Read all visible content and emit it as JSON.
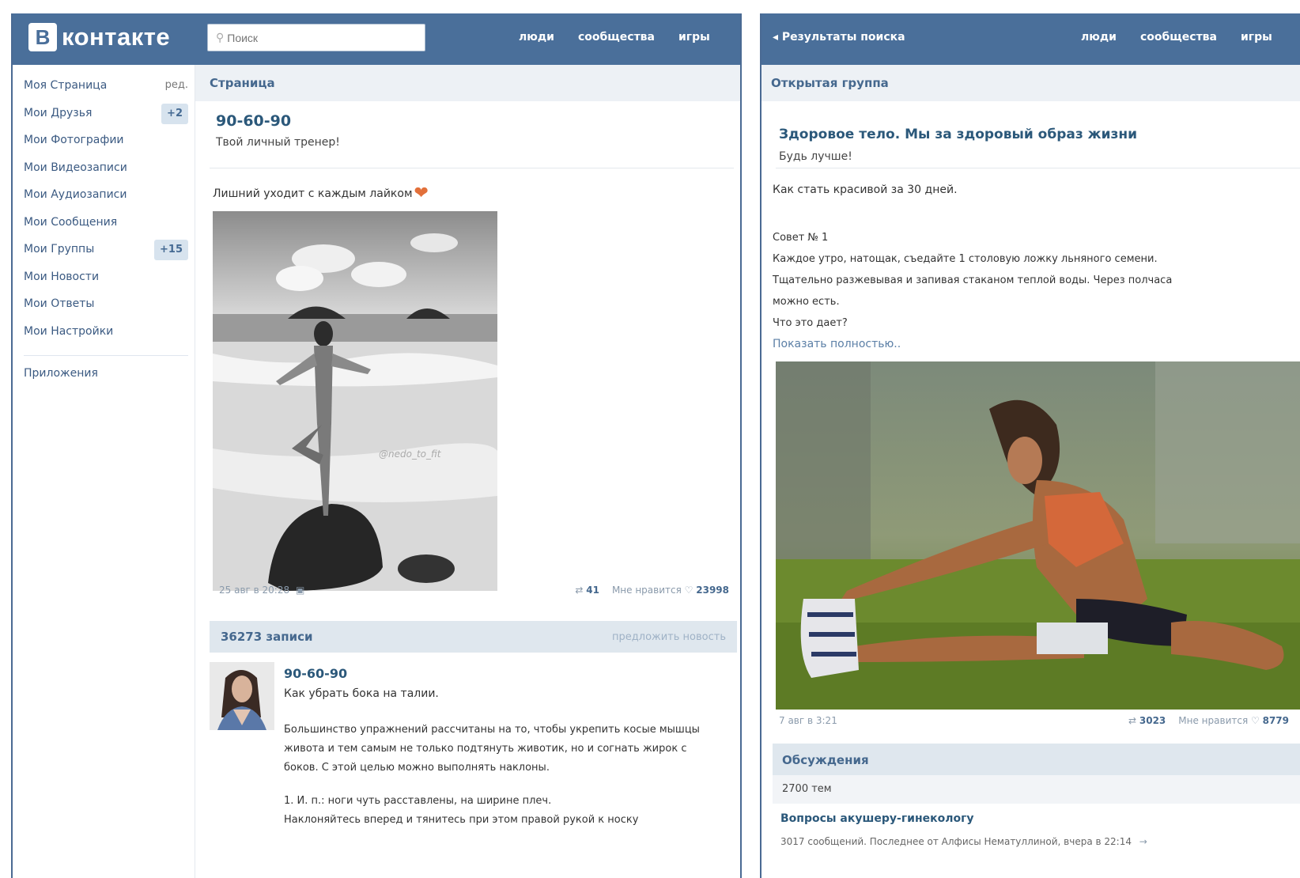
{
  "left": {
    "logo": {
      "letter": "В",
      "text": "контакте"
    },
    "search_placeholder": "Поиск",
    "nav": [
      "люди",
      "сообщества",
      "игры"
    ],
    "sidebar": {
      "items": [
        {
          "label": "Моя Страница",
          "extra": "ред."
        },
        {
          "label": "Мои Друзья",
          "badge": "+2"
        },
        {
          "label": "Мои Фотографии"
        },
        {
          "label": "Мои Видеозаписи"
        },
        {
          "label": "Мои Аудиозаписи"
        },
        {
          "label": "Мои Сообщения"
        },
        {
          "label": "Мои Группы",
          "badge": "+15"
        },
        {
          "label": "Мои Новости"
        },
        {
          "label": "Мои Ответы"
        },
        {
          "label": "Мои Настройки"
        }
      ],
      "apps": "Приложения"
    },
    "section_title": "Страница",
    "page": {
      "title": "90-60-90",
      "subtitle": "Твой личный тренер!"
    },
    "post": {
      "text": "Лишний уходит с каждым лайком",
      "heart": "❤",
      "watermark": "@nedo_to_fit",
      "date": "25 авг в 20:28",
      "reposts": "41",
      "likes_label": "Мне нравится",
      "likes": "23998"
    },
    "wall": {
      "count": "36273 записи",
      "link": "предложить новость"
    },
    "post2": {
      "author": "90-60-90",
      "title": "Как убрать бока на талии.",
      "p1": "Большинство упражнений рассчитаны на то, чтобы укрепить косые мышцы живота и тем самым не только подтянуть животик, но и согнать жирок с боков. С этой целью можно выполнять наклоны.",
      "p2": "1. И. п.: ноги чуть расставлены, на ширине плеч.",
      "p3": "Наклоняйтесь вперед и тянитесь при этом правой рукой к носку"
    }
  },
  "right": {
    "back": "Результаты поиска",
    "nav": [
      "люди",
      "сообщества",
      "игры"
    ],
    "section_title": "Открытая группа",
    "group": {
      "title": "Здоровое тело. Мы за здоровый образ жизни",
      "subtitle": "Будь лучше!"
    },
    "post": {
      "intro": "Как стать красивой за 30 дней.",
      "tip_title": "Совет № 1",
      "tip_l1": "Каждое утро, натощак, съедайте 1 столовую ложку льняного семени.",
      "tip_l2": "Тщательно разжевывая и запивая стаканом теплой воды. Через полчаса",
      "tip_l3": "можно есть.",
      "tip_l4": "Что это дает?",
      "more": "Показать полностью..",
      "date": "7 авг в 3:21",
      "reposts": "3023",
      "likes_label": "Мне нравится",
      "likes": "8779"
    },
    "discussions": {
      "title": "Обсуждения",
      "count": "2700 тем",
      "topic": "Вопросы акушеру-гинекологу",
      "topic_meta": "3017 сообщений. Последнее от Алфисы Нематуллиной, вчера в 22:14"
    }
  },
  "colors": {
    "header": "#4a6f9a",
    "link": "#2b587a",
    "section_bg": "#edf1f5"
  }
}
